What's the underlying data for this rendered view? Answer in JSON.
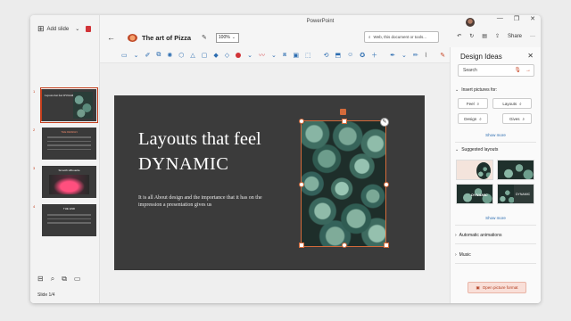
{
  "app": {
    "window_title": "PowerPoint",
    "document_title": "The art of Pizza",
    "zoom": "100%",
    "search_placeholder": "Web, this document or tools...",
    "undo_label": "↶",
    "share_label": "Share",
    "more_label": "···"
  },
  "rail": {
    "add_slide_label": "Add slide",
    "slide_counter": "Slide 1/4",
    "slides": [
      {
        "number": "1",
        "title": "Layouts that feel DYNAMIC"
      },
      {
        "number": "2",
        "title": "THE DESIGN"
      },
      {
        "number": "3",
        "title": "Smooth silhouette"
      },
      {
        "number": "4",
        "title": "THE END"
      }
    ]
  },
  "slide": {
    "title_line1": "Layouts that feel",
    "title_line2": "DYNAMIC",
    "body": "It is all About design and the importance that it has on the impression a presentation gives us"
  },
  "panel": {
    "title": "Design Ideas",
    "search_placeholder": "Search",
    "insert_pictures_heading": "Insert pictures for:",
    "chips": [
      "Feel",
      "Layouts",
      "Design",
      "Gives"
    ],
    "show_more": "Show more",
    "suggested_layouts_heading": "Suggested layouts",
    "layout_thumb_word": "DYNAMIC",
    "automatic_animations": "Automatic animations",
    "music": "Music",
    "open_picture_format": "Open picture format"
  },
  "icons": {
    "accent": "#c43e1c",
    "toolbar_blue": "#2b6cb0"
  }
}
